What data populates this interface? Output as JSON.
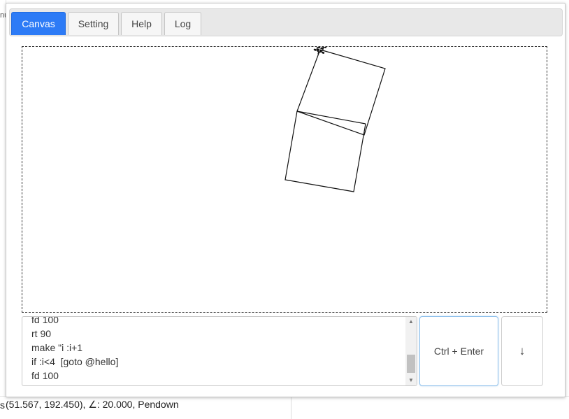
{
  "tabs": [
    {
      "label": "Canvas",
      "active": true
    },
    {
      "label": "Setting",
      "active": false
    },
    {
      "label": "Help",
      "active": false
    },
    {
      "label": "Log",
      "active": false
    }
  ],
  "editor": {
    "lines": [
      "fd 100",
      "rt 90",
      "make \"i :i+1",
      "if :i<4  [goto @hello]",
      "fd 100"
    ]
  },
  "buttons": {
    "run_label": "Ctrl + Enter",
    "down_label": "↓"
  },
  "status": {
    "text": "(51.567, 192.450), ∠: 20.000, Pendown"
  },
  "background": {
    "left_fragment": "nu",
    "left_s": "s"
  },
  "icons": {
    "turtle": "turtle-icon"
  },
  "colors": {
    "accent": "#2d7bf6",
    "run_border": "#8fc0ec"
  }
}
